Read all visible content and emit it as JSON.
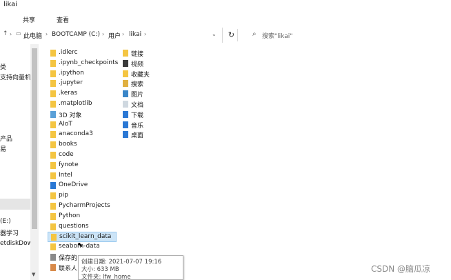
{
  "window": {
    "title": "likai"
  },
  "ribbon": {
    "tabs": [
      "共享",
      "查看"
    ]
  },
  "address": {
    "crumbs": [
      "此电脑",
      "BOOTCAMP (C:)",
      "用户",
      "likai"
    ],
    "search_placeholder": "搜索\"likai\""
  },
  "nav_pane": {
    "items": [
      "类",
      "支持向量机",
      "产品",
      "易",
      "(E:)",
      "器学习",
      "etdiskDow"
    ]
  },
  "files_col1": [
    {
      "name": ".idlerc",
      "icon": "folder-icon"
    },
    {
      "name": ".ipynb_checkpoints",
      "icon": "folder-icon"
    },
    {
      "name": ".ipython",
      "icon": "folder-icon"
    },
    {
      "name": ".jupyter",
      "icon": "folder-icon"
    },
    {
      "name": ".keras",
      "icon": "folder-icon"
    },
    {
      "name": ".matplotlib",
      "icon": "folder-icon"
    },
    {
      "name": "3D 对象",
      "icon": "3d-objects-icon"
    },
    {
      "name": "AIoT",
      "icon": "folder-icon"
    },
    {
      "name": "anaconda3",
      "icon": "folder-icon"
    },
    {
      "name": "books",
      "icon": "folder-icon"
    },
    {
      "name": "code",
      "icon": "folder-icon"
    },
    {
      "name": "fynote",
      "icon": "folder-icon"
    },
    {
      "name": "Intel",
      "icon": "folder-icon"
    },
    {
      "name": "OneDrive",
      "icon": "onedrive-icon"
    },
    {
      "name": "pip",
      "icon": "folder-icon"
    },
    {
      "name": "PycharmProjects",
      "icon": "folder-icon"
    },
    {
      "name": "Python",
      "icon": "folder-icon"
    },
    {
      "name": "questions",
      "icon": "folder-icon"
    },
    {
      "name": "scikit_learn_data",
      "icon": "folder-icon"
    },
    {
      "name": "seaborn-data",
      "icon": "folder-icon"
    },
    {
      "name": "保存的",
      "icon": "saved-games-icon"
    },
    {
      "name": "联系人",
      "icon": "contacts-icon"
    }
  ],
  "files_col2": [
    {
      "name": "链接",
      "icon": "links-icon"
    },
    {
      "name": "视频",
      "icon": "videos-icon"
    },
    {
      "name": "收藏夹",
      "icon": "favorites-icon"
    },
    {
      "name": "搜索",
      "icon": "searches-icon"
    },
    {
      "name": "图片",
      "icon": "pictures-icon"
    },
    {
      "name": "文档",
      "icon": "documents-icon"
    },
    {
      "name": "下载",
      "icon": "downloads-icon"
    },
    {
      "name": "音乐",
      "icon": "music-icon"
    },
    {
      "name": "桌面",
      "icon": "desktop-icon"
    }
  ],
  "tooltip": {
    "created": "创建日期: 2021-07-07 19:16",
    "size": "大小: 633 MB",
    "folders": "文件夹: lfw_home"
  },
  "watermark": "CSDN @脑瓜凉",
  "colors": {
    "folder": "#f4c542",
    "selection": "#cce4f7",
    "selection_border": "#99c9ef",
    "accent": "#2b78d4"
  }
}
